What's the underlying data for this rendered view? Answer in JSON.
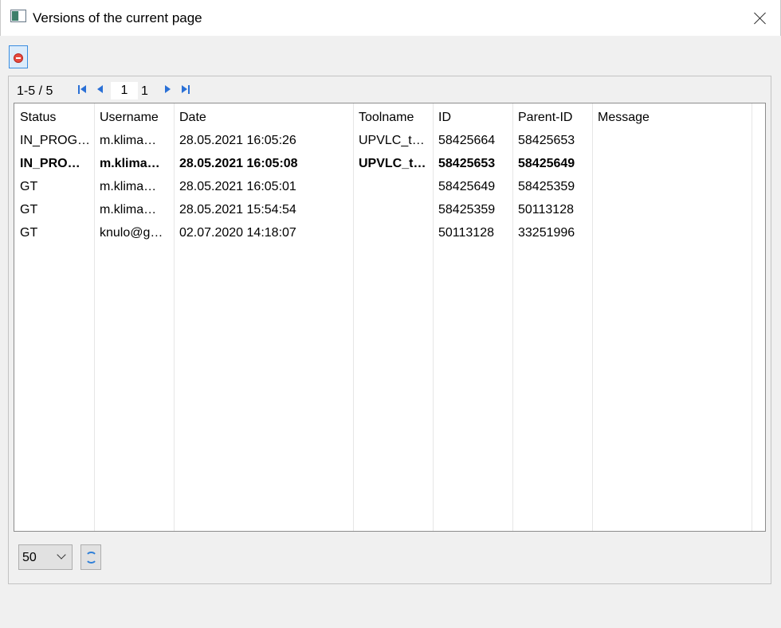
{
  "window": {
    "title": "Versions of the current page",
    "icon": "app-window-icon"
  },
  "toolbar": {
    "stop_icon": "stop-icon"
  },
  "pager": {
    "range": "1-5 / 5",
    "current_page": "1",
    "total_pages": "1"
  },
  "table": {
    "columns": [
      "Status",
      "Username",
      "Date",
      "Toolname",
      "ID",
      "Parent-ID",
      "Message"
    ],
    "rows": [
      {
        "status": "IN_PROG…",
        "username": "m.klima…",
        "date": "28.05.2021 16:05:26",
        "toolname": "UPVLC_tS…",
        "id": "58425664",
        "parent_id": "58425653",
        "message": "",
        "selected": false
      },
      {
        "status": "IN_PRO…",
        "username": "m.klima…",
        "date": "28.05.2021 16:05:08",
        "toolname": "UPVLC_t…",
        "id": "58425653",
        "parent_id": "58425649",
        "message": "",
        "selected": true
      },
      {
        "status": "GT",
        "username": "m.klima…",
        "date": "28.05.2021 16:05:01",
        "toolname": "",
        "id": "58425649",
        "parent_id": "58425359",
        "message": "",
        "selected": false
      },
      {
        "status": "GT",
        "username": "m.klima…",
        "date": "28.05.2021 15:54:54",
        "toolname": "",
        "id": "58425359",
        "parent_id": "50113128",
        "message": "",
        "selected": false
      },
      {
        "status": "GT",
        "username": "knulo@g…",
        "date": "02.07.2020 14:18:07",
        "toolname": "",
        "id": "50113128",
        "parent_id": "33251996",
        "message": "",
        "selected": false
      }
    ]
  },
  "footer": {
    "page_size": "50",
    "refresh_icon": "refresh-icon"
  }
}
